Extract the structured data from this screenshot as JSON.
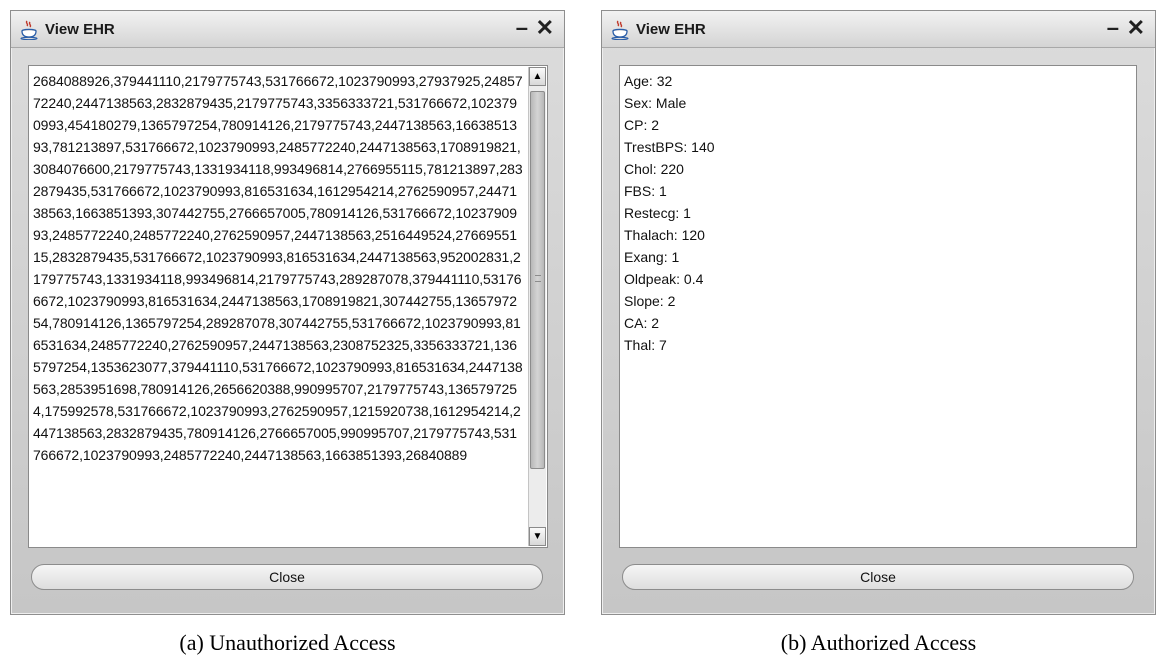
{
  "unauthorized_window": {
    "title": "View EHR",
    "encrypted_record": "2684088926,379441110,2179775743,531766672,1023790993,27937925,2485772240,2447138563,2832879435,2179775743,3356333721,531766672,1023790993,454180279,1365797254,780914126,2179775743,2447138563,1663851393,781213897,531766672,1023790993,2485772240,2447138563,1708919821,3084076600,2179775743,1331934118,993496814,2766955115,781213897,2832879435,531766672,1023790993,816531634,1612954214,2762590957,2447138563,1663851393,307442755,2766657005,780914126,531766672,1023790993,2485772240,2485772240,2762590957,2447138563,2516449524,2766955115,2832879435,531766672,1023790993,816531634,2447138563,952002831,2179775743,1331934118,993496814,2179775743,289287078,379441110,531766672,1023790993,816531634,2447138563,1708919821,307442755,1365797254,780914126,1365797254,289287078,307442755,531766672,1023790993,816531634,2485772240,2762590957,2447138563,2308752325,3356333721,1365797254,1353623077,379441110,531766672,1023790993,816531634,2447138563,2853951698,780914126,2656620388,990995707,2179775743,1365797254,175992578,531766672,1023790993,2762590957,1215920738,1612954214,2447138563,2832879435,780914126,2766657005,990995707,2179775743,531766672,1023790993,2485772240,2447138563,1663851393,26840889",
    "close_label": "Close",
    "scroll_up_glyph": "▲",
    "scroll_down_glyph": "▼"
  },
  "authorized_window": {
    "title": "View EHR",
    "record_fields": [
      "Age: 32",
      "Sex: Male",
      "CP: 2",
      "TrestBPS: 140",
      "Chol: 220",
      "FBS: 1",
      "Restecg: 1",
      "Thalach: 120",
      "Exang: 1",
      "Oldpeak: 0.4",
      "Slope: 2",
      "CA: 2",
      "Thal: 7"
    ],
    "close_label": "Close"
  },
  "window_controls": {
    "minimize_glyph": "–",
    "close_glyph": "✕"
  },
  "captions": {
    "a": "(a) Unauthorized Access",
    "b": "(b) Authorized Access"
  }
}
